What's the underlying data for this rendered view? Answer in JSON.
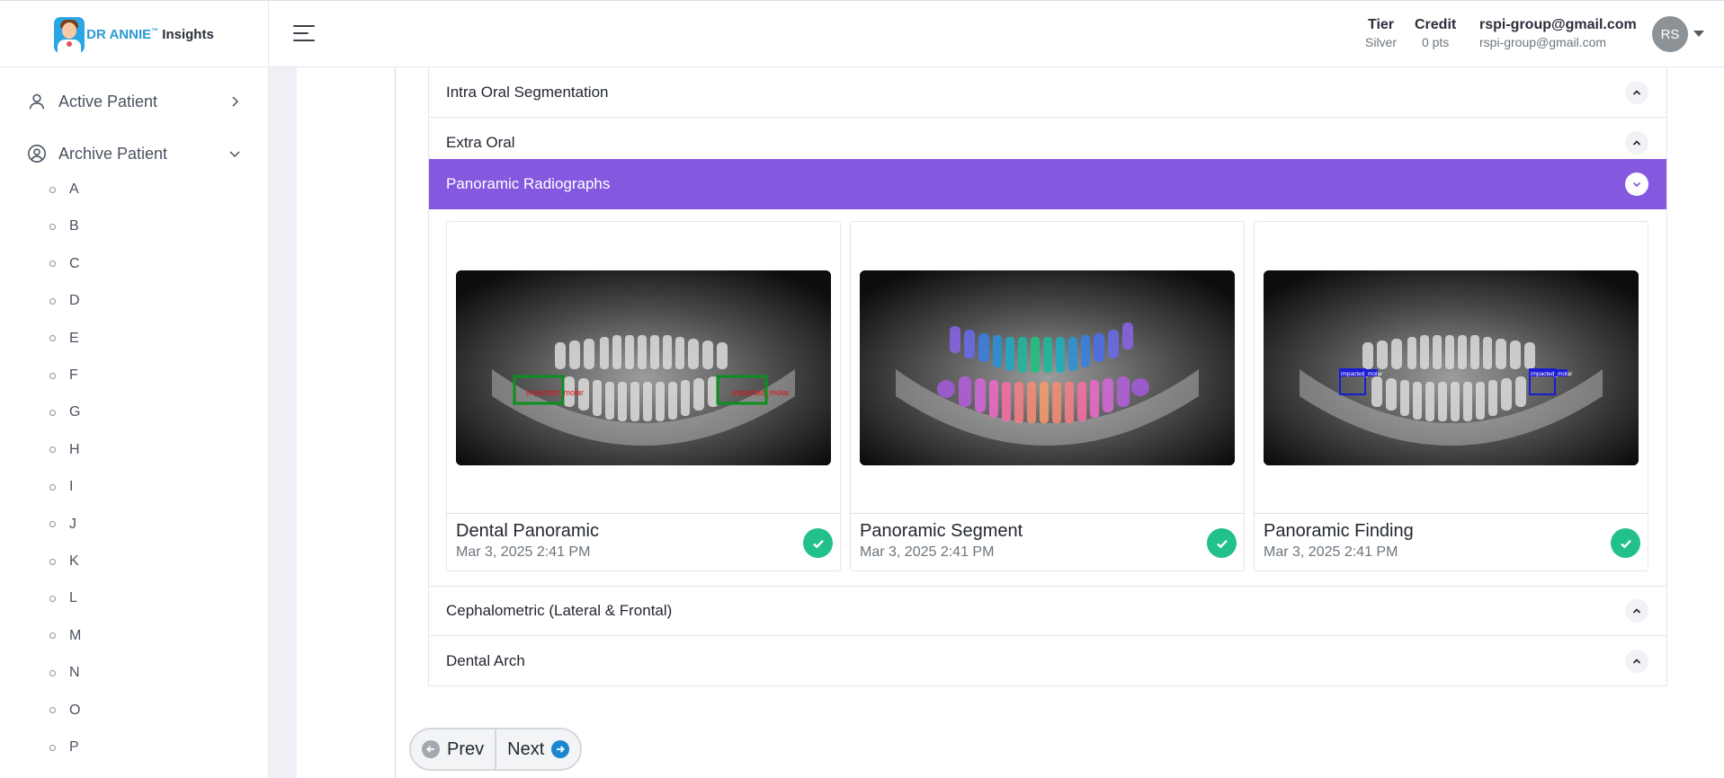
{
  "brand": {
    "name": "DR ANNIE",
    "tm": "™",
    "suffix": "Insights"
  },
  "header": {
    "tier_label": "Tier",
    "tier_value": "Silver",
    "credit_label": "Credit",
    "credit_value": "0 pts",
    "user_name": "rspi-group@gmail.com",
    "user_email": "rspi-group@gmail.com",
    "avatar_initials": "RS"
  },
  "sidebar": {
    "active_patient": "Active Patient",
    "archive_patient": "Archive Patient",
    "letters": [
      "A",
      "B",
      "C",
      "D",
      "E",
      "F",
      "G",
      "H",
      "I",
      "J",
      "K",
      "L",
      "M",
      "N",
      "O",
      "P"
    ]
  },
  "accordion": {
    "sections": [
      "Intra Oral Segmentation",
      "Extra Oral",
      "Panoramic Radiographs",
      "Cephalometric (Lateral & Frontal)",
      "Dental Arch"
    ],
    "active_section": "Panoramic Radiographs"
  },
  "cards": [
    {
      "title": "Dental Panoramic",
      "date": "Mar 3, 2025 2:41 PM",
      "status": "completed",
      "box_labels": [
        "impacted_molar",
        "impacted_molar"
      ]
    },
    {
      "title": "Panoramic Segment",
      "date": "Mar 3, 2025 2:41 PM",
      "status": "completed"
    },
    {
      "title": "Panoramic Finding",
      "date": "Mar 3, 2025 2:41 PM",
      "status": "completed",
      "box_labels": [
        "impacted_molar",
        "impacted_molar"
      ]
    }
  ],
  "pager": {
    "prev": "Prev",
    "next": "Next"
  },
  "colors": {
    "accent": "#8459e0",
    "success": "#22c08b",
    "brand": "#2a9bd6",
    "next_icon": "#1c87cf"
  }
}
